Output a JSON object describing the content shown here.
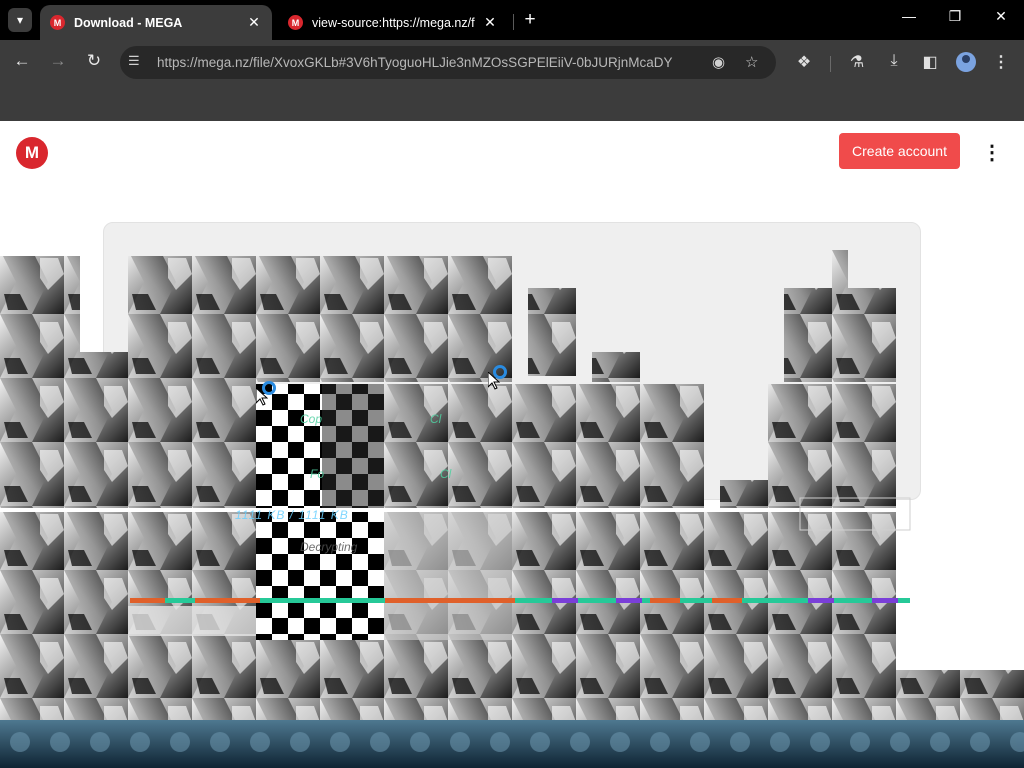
{
  "browser": {
    "tabs": [
      {
        "title": "Download - MEGA",
        "active": true
      },
      {
        "title": "view-source:https://mega.nz/f",
        "active": false
      }
    ],
    "favicon_letter": "M",
    "new_tab_glyph": "+",
    "close_glyph": "✕",
    "address_url": "https://mega.nz/file/XvoxGKLb#3V6hTyoguoHLJie3nMZOsSGPElEiiV-0bJURjnMcaDY",
    "window_controls": {
      "minimize": "—",
      "restore": "❐",
      "close": "✕"
    },
    "icons": [
      "back-icon",
      "forward-icon",
      "reload-icon",
      "site-info-icon",
      "eye-off-icon",
      "star-icon",
      "extensions-icon",
      "labs-icon",
      "download-icon",
      "side-panel-icon",
      "profile-icon",
      "menu-icon"
    ]
  },
  "page": {
    "logo_letter": "M",
    "create_account_label": "Create account",
    "menu_glyph": "⋮",
    "card_color": "#efefef",
    "glitch_fragments": [
      "Cop",
      "Cl",
      "Fo",
      "Cl",
      "1111 KB / 1111 KB",
      "Decrypting"
    ]
  },
  "colors": {
    "brand_red": "#d9272e",
    "button_red": "#f04b4b",
    "chrome_dark": "#3c3c3c",
    "tab_bar": "#000000",
    "progress_green": "#26c998",
    "progress_orange": "#e0602a",
    "progress_purple": "#7a3fd8"
  }
}
